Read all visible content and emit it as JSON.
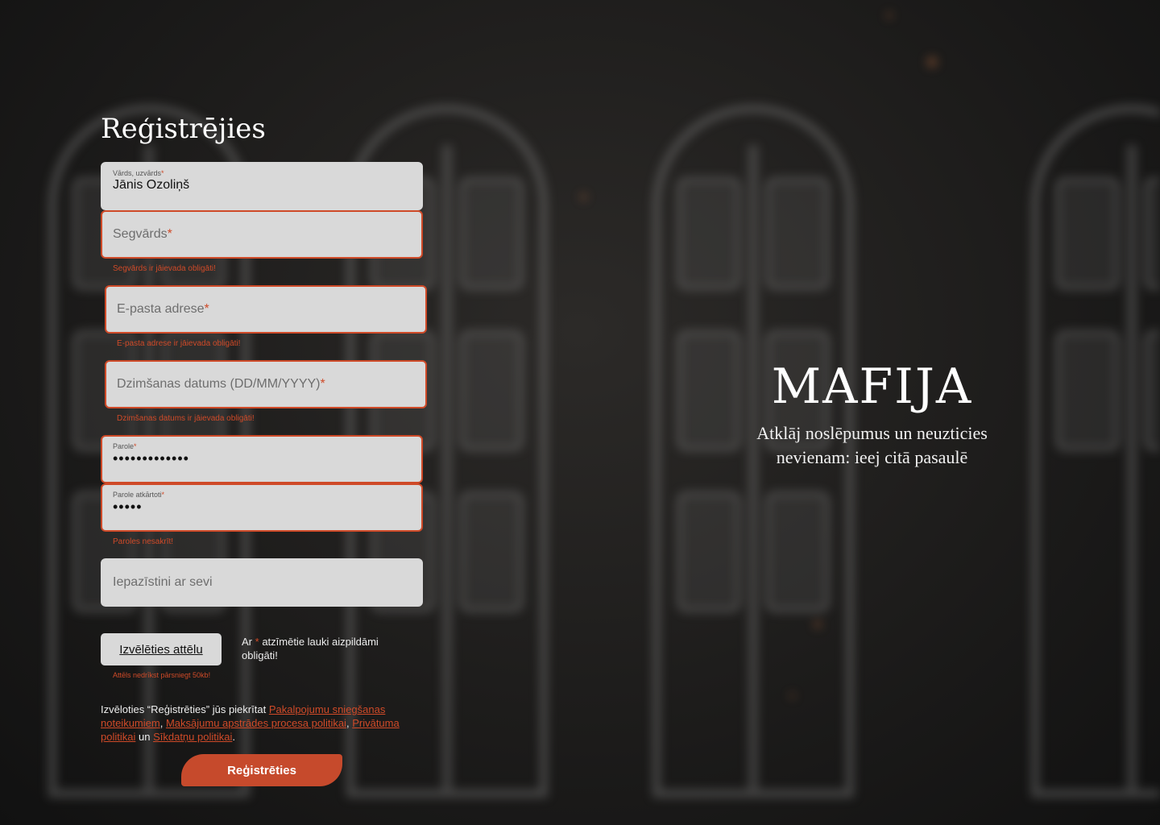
{
  "page": {
    "title": "Reģistrējies",
    "required_mark": "*"
  },
  "form": {
    "name": {
      "label": "Vārds, uzvārds",
      "value": "Jānis Ozoliņš"
    },
    "username": {
      "placeholder": "Segvārds",
      "error": "Segvārds ir jāievada obligāti!"
    },
    "email": {
      "placeholder": "E-pasta adrese",
      "error": "E-pasta adrese ir jāievada obligāti!"
    },
    "birthdate": {
      "placeholder": "Dzimšanas datums (DD/MM/YYYY)",
      "error": "Dzimšanas datums ir jāievada obligāti!"
    },
    "password": {
      "label": "Parole",
      "value": "•••••••••••••"
    },
    "password_repeat": {
      "label": "Parole atkārtoti",
      "value": "•••••",
      "error": "Paroles nesakrīt!"
    },
    "about": {
      "placeholder": "Iepazīstini ar sevi"
    },
    "upload": {
      "button": "Izvēlēties attēlu",
      "error": "Attēls nedrīkst pārsniegt 50kb!"
    },
    "required_note": {
      "prefix": "Ar",
      "suffix": "atzīmētie lauki aizpildāmi obligāti!"
    },
    "terms": {
      "intro": "Izvēloties “Reģistrēties” jūs piekrītat",
      "link_service": "Pakalpojumu sniegšanas noteikumiem",
      "sep1": ",",
      "link_payment": "Maksājumu apstrādes procesa politikai",
      "sep2": ",",
      "link_privacy": "Privātuma politikai",
      "and": "un",
      "link_cookies": "Sīkdatņu politikai",
      "end": "."
    },
    "submit": "Reģistrēties"
  },
  "brand": {
    "logo": "MAFIJA",
    "tagline_line1": "Atklāj noslēpumus un neuzticies",
    "tagline_line2": "nevienam: ieej citā pasaulē"
  },
  "colors": {
    "accent": "#c64a2c",
    "error": "#cf4a28",
    "field_bg": "#d9d9d9",
    "background": "#1d1c1b"
  }
}
